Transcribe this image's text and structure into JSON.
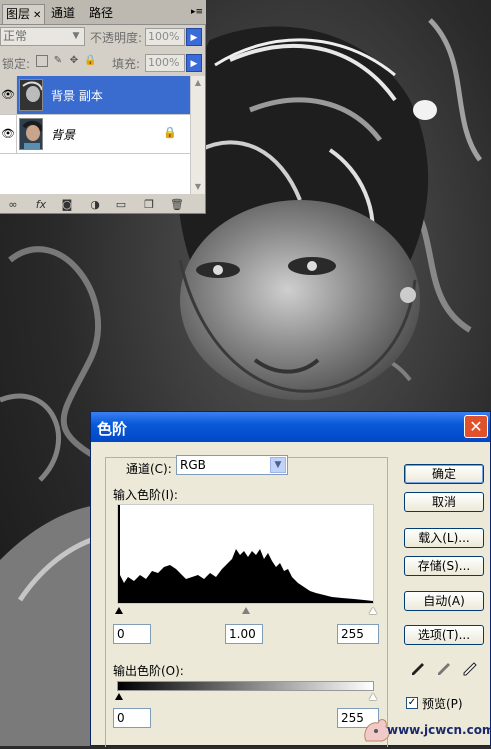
{
  "layers_panel": {
    "tabs": [
      {
        "label": "图层",
        "active": true
      },
      {
        "label": "通道",
        "active": false
      },
      {
        "label": "路径",
        "active": false
      }
    ],
    "blend_mode": "正常",
    "opacity_label": "不透明度:",
    "opacity_value": "100%",
    "lock_label": "锁定:",
    "fill_label": "填充:",
    "fill_value": "100%",
    "layers": [
      {
        "name": "背景 副本",
        "selected": true,
        "visible": true,
        "locked": false
      },
      {
        "name": "背景",
        "selected": false,
        "visible": true,
        "locked": true
      }
    ],
    "bottom_icons": [
      "link-icon",
      "fx-icon",
      "mask-icon",
      "adjustment-icon",
      "folder-icon",
      "new-layer-icon",
      "trash-icon"
    ]
  },
  "levels_dialog": {
    "title": "色阶",
    "channel_label": "通道(C):",
    "channel_value": "RGB",
    "input_levels_label": "输入色阶(I):",
    "input_black": "0",
    "input_gamma": "1.00",
    "input_white": "255",
    "output_levels_label": "输出色阶(O):",
    "output_black": "0",
    "output_white": "255",
    "buttons": {
      "ok": "确定",
      "cancel": "取消",
      "load": "载入(L)...",
      "save": "存储(S)...",
      "auto": "自动(A)",
      "options": "选项(T)..."
    },
    "preview_label": "预览(P)",
    "preview_checked": true
  },
  "watermark": "www.jcwcn.com",
  "colors": {
    "panel_bg": "#d4d0c8",
    "selected_layer": "#3a6ccf",
    "dialog_title": "#0a5ad8",
    "dialog_bg": "#ece9d8",
    "close_button": "#e0522b"
  }
}
